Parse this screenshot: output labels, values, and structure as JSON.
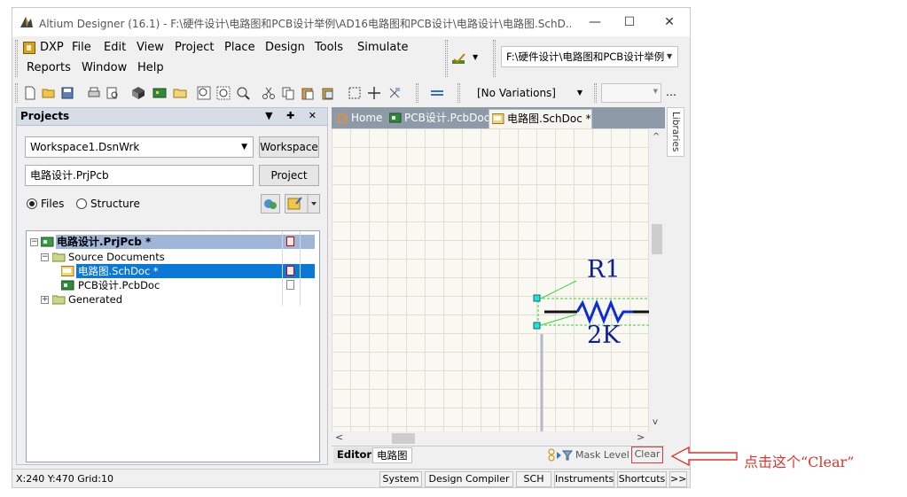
{
  "window": {
    "title": "Altium Designer (16.1) - F:\\硬件设计\\电路图和PCB设计举例\\AD16电路图和PCB设计\\电路设计\\电路图.SchD...",
    "minimize": "—",
    "maximize": "☐",
    "close": "✕"
  },
  "menu": {
    "items": [
      "DXP",
      "File",
      "Edit",
      "View",
      "Project",
      "Place",
      "Design",
      "Tools",
      "Simulate",
      "Reports",
      "Window",
      "Help"
    ],
    "path_combo": "F:\\硬件设计\\电路图和PCB设计举例"
  },
  "toolbar": {
    "variations": "[No Variations]",
    "icons": [
      "new-doc",
      "open-folder",
      "save",
      "print",
      "print-preview",
      "3d-view",
      "pcb",
      "folder",
      "zoom-in",
      "zoom-fit",
      "zoom-select",
      "cut",
      "copy",
      "paste",
      "paste-special",
      "select-rect",
      "move",
      "deselect",
      "cross-probe"
    ]
  },
  "projects": {
    "title": "Projects",
    "header_buttons": "▼ ✚ ✕",
    "workspace": "Workspace1.DsnWrk",
    "workspace_button": "Workspace",
    "project": "电路设计.PrjPcb",
    "project_button": "Project",
    "view_files": "Files",
    "view_structure": "Structure",
    "tree": {
      "root": "电路设计.PrjPcb *",
      "source_documents": "Source Documents",
      "schdoc": "电路图.SchDoc *",
      "pcbdoc": "PCB设计.PcbDoc",
      "generated": "Generated"
    }
  },
  "doc_tabs": [
    "Home",
    "PCB设计.PcbDoc",
    "电路图.SchDoc *"
  ],
  "schematic": {
    "designator": "R1",
    "value": "2K"
  },
  "editor_bar": {
    "tab_editor": "Editor",
    "tab_sheet": "电路图",
    "mask_level": "Mask Level",
    "clear": "Clear"
  },
  "libraries_tab": "Libraries",
  "status": {
    "coords": "X:240 Y:470   Grid:10",
    "buttons": [
      "System",
      "Design Compiler",
      "SCH",
      "Instruments",
      "Shortcuts",
      ">>"
    ]
  },
  "annotation": {
    "text": "点击这个“Clear”"
  },
  "colors": {
    "panel_header": "#d6dde6",
    "selection": "#0a78d7",
    "schematic_text": "#0b1f8f",
    "annotation": "#d9362b"
  }
}
